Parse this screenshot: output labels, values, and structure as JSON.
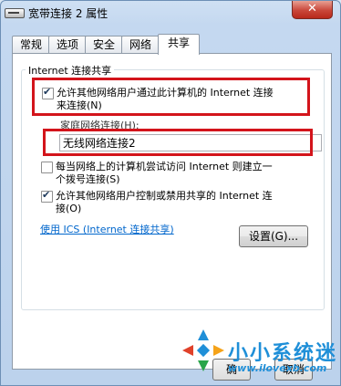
{
  "window": {
    "title": "宽带连接 2 属性",
    "close_label": "✕"
  },
  "tabs": [
    {
      "label": "常规",
      "active": false
    },
    {
      "label": "选项",
      "active": false
    },
    {
      "label": "安全",
      "active": false
    },
    {
      "label": "网络",
      "active": false
    },
    {
      "label": "共享",
      "active": true
    }
  ],
  "sharing": {
    "group_title": "Internet 连接共享",
    "allow_share": {
      "checked": true,
      "label_line1": "允许其他网络用户通过此计算机的 Internet 连接",
      "label_line2": "来连接(N)"
    },
    "home_network_label": "家庭网络连接(H):",
    "home_network_value": "无线网络连接2",
    "dial_on_demand": {
      "checked": false,
      "label_line1": "每当网络上的计算机尝试访问 Internet 则建立一",
      "label_line2": "个拨号连接(S)"
    },
    "allow_control": {
      "checked": true,
      "label_line1": "允许其他网络用户控制或禁用共享的 Internet 连",
      "label_line2": "接(O)"
    },
    "ics_link": "使用 ICS (Internet 连接共享)",
    "settings_button": "设置(G)..."
  },
  "footer": {
    "ok_partial": "确",
    "cancel_partial": "取消"
  },
  "watermark": {
    "title": "小小系统迷",
    "url": "www.ilovexb.com"
  },
  "colors": {
    "highlight": "#d3141b",
    "link": "#0066cc",
    "watermark": "#1f8fd8"
  }
}
